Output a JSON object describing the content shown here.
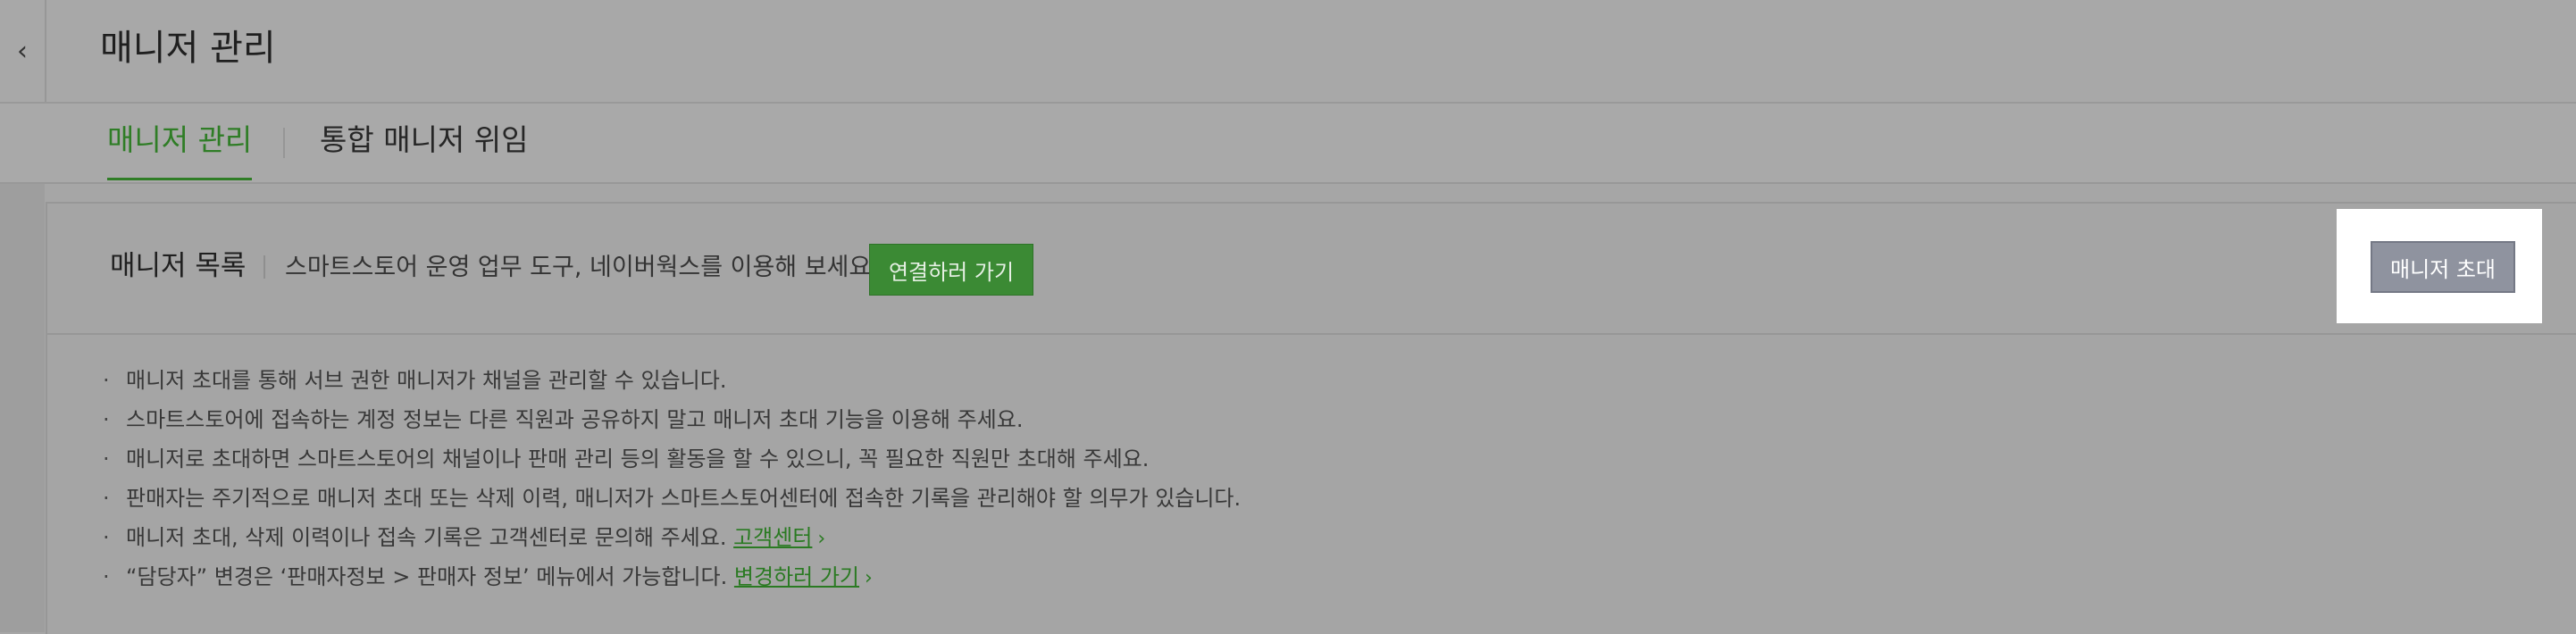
{
  "header": {
    "title": "매니저 관리",
    "back_icon": "chevron-left-icon"
  },
  "tabs": [
    {
      "label": "매니저 관리",
      "active": true
    },
    {
      "label": "통합 매니저 위임",
      "active": false
    }
  ],
  "panel": {
    "list_title": "매니저 목록",
    "description": "스마트스토어 운영 업무 도구, 네이버웍스를 이용해 보세요.",
    "connect_button": "연결하러 가기",
    "invite_button": "매니저 초대"
  },
  "notes": [
    {
      "text": "매니저 초대를 통해 서브 권한 매니저가 채널을 관리할 수 있습니다."
    },
    {
      "text": "스마트스토어에 접속하는 계정 정보는 다른 직원과 공유하지 말고 매니저 초대 기능을 이용해 주세요."
    },
    {
      "text": "매니저로 초대하면 스마트스토어의 채널이나 판매 관리 등의 활동을 할 수 있으니, 꼭 필요한 직원만 초대해 주세요."
    },
    {
      "text": "판매자는 주기적으로 매니저 초대 또는 삭제 이력, 매니저가 스마트스토어센터에 접속한 기록을 관리해야 할 의무가 있습니다."
    },
    {
      "text": "매니저 초대, 삭제 이력이나 접속 기록은 고객센터로 문의해 주세요.",
      "link": "고객센터"
    },
    {
      "text": "“담당자” 변경은 ‘판매자정보 > 판매자 정보’ 메뉴에서 가능합니다.",
      "link": "변경하러 가기"
    }
  ],
  "colors": {
    "accent_green": "#2f7d26",
    "button_green": "#3b8a34",
    "invite_button": "#8f939f"
  }
}
